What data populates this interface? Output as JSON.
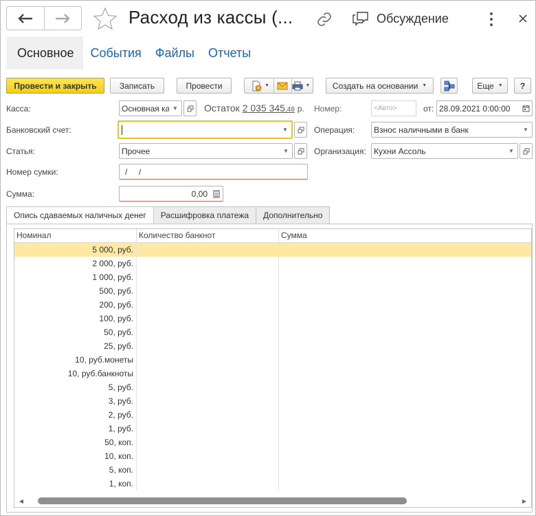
{
  "window": {
    "title": "Расход из кассы (...",
    "discussion_label": "Обсуждение",
    "colors": {
      "primary_button": "#f3cf10",
      "link": "#1a64b5",
      "selected_row": "#fde9a1",
      "focus_border": "#f0c419"
    }
  },
  "sections": [
    {
      "label": "Основное",
      "active": true
    },
    {
      "label": "События"
    },
    {
      "label": "Файлы"
    },
    {
      "label": "Отчеты"
    }
  ],
  "toolbar": {
    "post_close": "Провести и закрыть",
    "save": "Записать",
    "post": "Провести",
    "create_based": "Создать на основании",
    "more": "Еще",
    "help": "?"
  },
  "form": {
    "kassa_label": "Касса:",
    "kassa_value": "Основная ка",
    "ostatok_label": "Остаток",
    "ostatok_amount": "2 035 345",
    "ostatok_kop": ",48",
    "ostatok_unit": "р.",
    "number_label": "Номер:",
    "number_placeholder": "<Авто>",
    "date_label": "от:",
    "date_value": "28.09.2021  0:00:00",
    "bank_account_label": "Банковский счет:",
    "bank_account_value": "",
    "operation_label": "Операция:",
    "operation_value": "Взнос наличными в банк",
    "article_label": "Статья:",
    "article_value": "Прочее",
    "organization_label": "Организация:",
    "organization_value": "Кухни Ассоль",
    "bag_number_label": "Номер сумки:",
    "bag_number_value": "/     /",
    "amount_label": "Сумма:",
    "amount_value": "0,00"
  },
  "tabs": [
    {
      "label": "Опись сдаваемых наличных денег",
      "active": true
    },
    {
      "label": "Расшифровка платежа"
    },
    {
      "label": "Дополнительно"
    }
  ],
  "table": {
    "columns": [
      "Номинал",
      "Количество банкнот",
      "Сумма"
    ],
    "rows": [
      {
        "nominal": "5 000, руб.",
        "count": "",
        "sum": "",
        "selected": true
      },
      {
        "nominal": "2 000, руб.",
        "count": "",
        "sum": ""
      },
      {
        "nominal": "1 000, руб.",
        "count": "",
        "sum": ""
      },
      {
        "nominal": "500, руб.",
        "count": "",
        "sum": ""
      },
      {
        "nominal": "200, руб.",
        "count": "",
        "sum": ""
      },
      {
        "nominal": "100, руб.",
        "count": "",
        "sum": ""
      },
      {
        "nominal": "50, руб.",
        "count": "",
        "sum": ""
      },
      {
        "nominal": "25, руб.",
        "count": "",
        "sum": ""
      },
      {
        "nominal": "10, руб.монеты",
        "count": "",
        "sum": ""
      },
      {
        "nominal": "10, руб.банкноты",
        "count": "",
        "sum": ""
      },
      {
        "nominal": "5, руб.",
        "count": "",
        "sum": ""
      },
      {
        "nominal": "3, руб.",
        "count": "",
        "sum": ""
      },
      {
        "nominal": "2, руб.",
        "count": "",
        "sum": ""
      },
      {
        "nominal": "1, руб.",
        "count": "",
        "sum": ""
      },
      {
        "nominal": "50, коп.",
        "count": "",
        "sum": ""
      },
      {
        "nominal": "10, коп.",
        "count": "",
        "sum": ""
      },
      {
        "nominal": "5, коп.",
        "count": "",
        "sum": ""
      },
      {
        "nominal": "1, коп.",
        "count": "",
        "sum": ""
      }
    ]
  }
}
